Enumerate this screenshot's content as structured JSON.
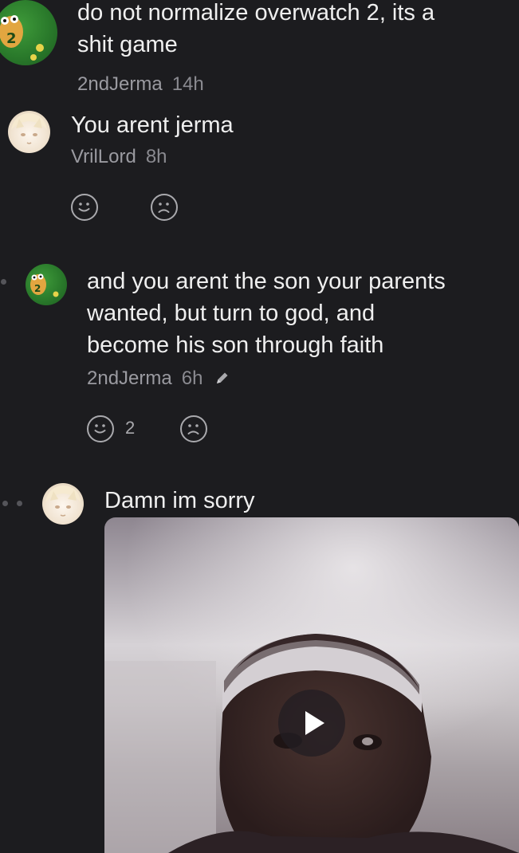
{
  "comments": [
    {
      "author": "2ndJerma",
      "time": "14h",
      "text_line1": "do not normalize overwatch 2, its a",
      "text_line2": "shit game",
      "avatar": "green-crocodile-avatar"
    },
    {
      "author": "VrilLord",
      "time": "8h",
      "text": "You arent jerma",
      "avatar": "anime-avatar",
      "reactions": {
        "like_icon": "smile-icon",
        "dislike_icon": "frown-icon"
      }
    },
    {
      "author": "2ndJerma",
      "time": "6h",
      "edited_icon": "pencil-icon",
      "text_line1": "and you arent the son your parents",
      "text_line2": "wanted, but turn to god, and",
      "text_line3": "become his son through faith",
      "avatar": "green-crocodile-avatar",
      "reactions": {
        "like_count": "2",
        "like_icon": "smile-icon",
        "dislike_icon": "frown-icon"
      }
    },
    {
      "author": "",
      "text": "Damn im sorry",
      "avatar": "anime-avatar",
      "attachment": {
        "type": "video",
        "icon": "play-icon"
      }
    }
  ],
  "colors": {
    "background": "#1c1c1f",
    "text": "#efefef",
    "meta": "#9a9aa0"
  }
}
